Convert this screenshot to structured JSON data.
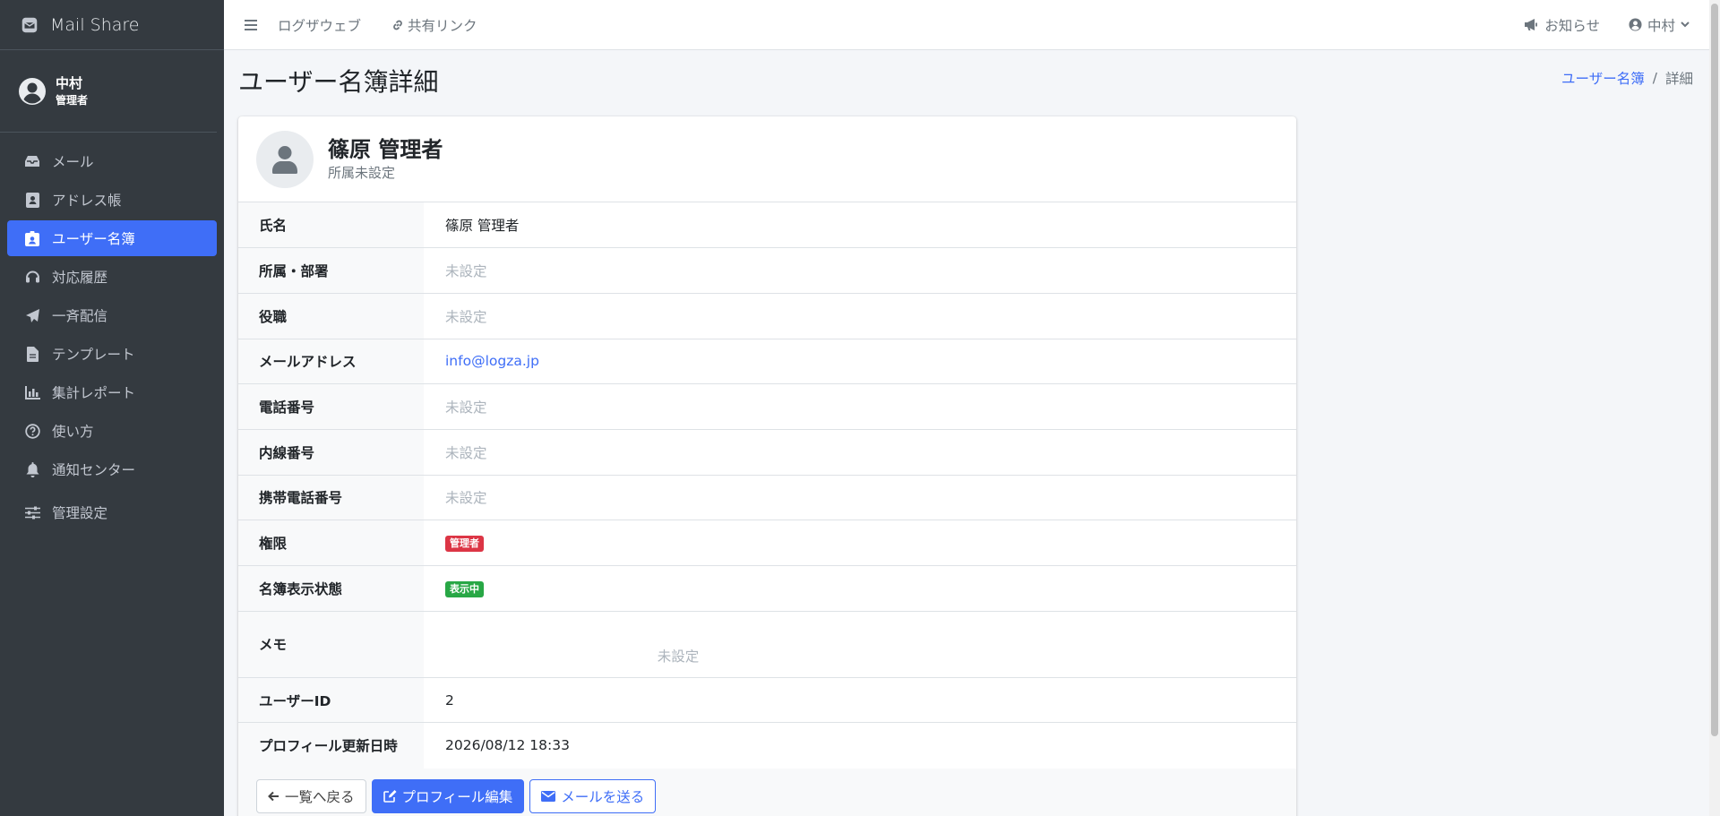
{
  "app": {
    "name": "Mail Share"
  },
  "user": {
    "name": "中村",
    "role": "管理者"
  },
  "sidebar": {
    "items": [
      {
        "label": "メール",
        "icon": "inbox-icon"
      },
      {
        "label": "アドレス帳",
        "icon": "address-book-icon"
      },
      {
        "label": "ユーザー名簿",
        "icon": "id-badge-icon",
        "active": true
      },
      {
        "label": "対応履歴",
        "icon": "headset-icon"
      },
      {
        "label": "一斉配信",
        "icon": "paper-plane-icon"
      },
      {
        "label": "テンプレート",
        "icon": "file-icon"
      },
      {
        "label": "集計レポート",
        "icon": "bar-chart-icon"
      },
      {
        "label": "使い方",
        "icon": "question-circle-icon"
      },
      {
        "label": "通知センター",
        "icon": "bell-icon"
      },
      {
        "label": "管理設定",
        "icon": "sliders-icon"
      }
    ]
  },
  "topbar": {
    "links": [
      "ログザウェブ",
      "共有リンク"
    ],
    "notifications": "お知らせ",
    "user": "中村"
  },
  "page": {
    "title": "ユーザー名簿詳細",
    "breadcrumb": {
      "parent": "ユーザー名簿",
      "separator": "/",
      "current": "詳細"
    }
  },
  "profile": {
    "name": "篠原 管理者",
    "department": "所属未設定"
  },
  "details": [
    {
      "label": "氏名",
      "value": "篠原 管理者"
    },
    {
      "label": "所属・部署",
      "value": "未設定"
    },
    {
      "label": "役職",
      "value": "未設定"
    },
    {
      "label": "メールアドレス",
      "value": "info@logza.jp"
    },
    {
      "label": "電話番号",
      "value": "未設定"
    },
    {
      "label": "内線番号",
      "value": "未設定"
    },
    {
      "label": "携帯電話番号",
      "value": "未設定"
    },
    {
      "label": "権限",
      "value": "管理者"
    },
    {
      "label": "名簿表示状態",
      "value": "表示中"
    },
    {
      "label": "メモ",
      "value": "未設定"
    },
    {
      "label": "ユーザーID",
      "value": "2"
    },
    {
      "label": "プロフィール更新日時",
      "value": "2026/08/12 18:33"
    }
  ],
  "actions": {
    "back": "一覧へ戻る",
    "edit": "プロフィール編集",
    "mail": "メールを送る"
  },
  "colors": {
    "sidebar_bg": "#343a40",
    "accent": "#3f6ef7",
    "badge_admin": "#dc3545",
    "badge_visible": "#28a745"
  }
}
